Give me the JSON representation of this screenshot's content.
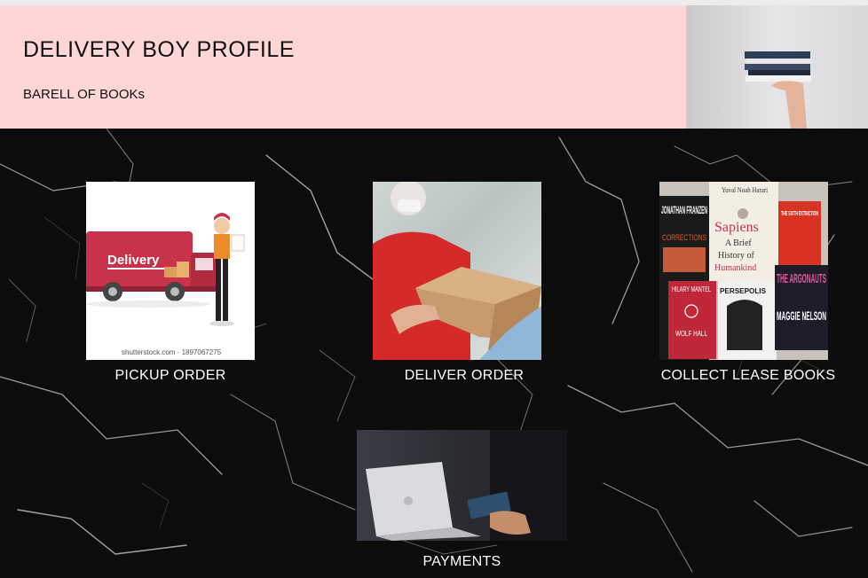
{
  "header": {
    "title": "DELIVERY BOY PROFILE",
    "subtitle": "BARELL OF BOOKs"
  },
  "header_image": {
    "icon": "hand-holding-books-photo"
  },
  "cards": [
    {
      "id": "pickup",
      "label": "PICKUP ORDER",
      "image_text": "Delivery",
      "watermark": "shutterstock.com · 1897067275"
    },
    {
      "id": "deliver",
      "label": "DELIVER ORDER"
    },
    {
      "id": "collect",
      "label": "COLLECT LEASE BOOKS",
      "books": {
        "franzen": "JONATHAN FRANZEN",
        "corrections": "CORRECTIONS",
        "sapiens_author": "Yuval Noah Harari",
        "sapiens_title": "Sapiens",
        "sapiens_sub1": "A Brief",
        "sapiens_sub2": "History of",
        "sapiens_sub3": "Humankind",
        "sixth": "THE SIXTH EXTINCTION",
        "hilary": "HILARY MANTEL",
        "wolf": "WOLF HALL",
        "persepolis": "PERSEPOLIS",
        "argonauts": "THE ARGONAUTS",
        "maggie": "MAGGIE NELSON"
      }
    },
    {
      "id": "payments",
      "label": "PAYMENTS"
    }
  ],
  "colors": {
    "header_bg": "#ffd6d6",
    "main_bg": "#0c0c0c",
    "van_red": "#c8324a",
    "shirt_red": "#d42a2a"
  }
}
